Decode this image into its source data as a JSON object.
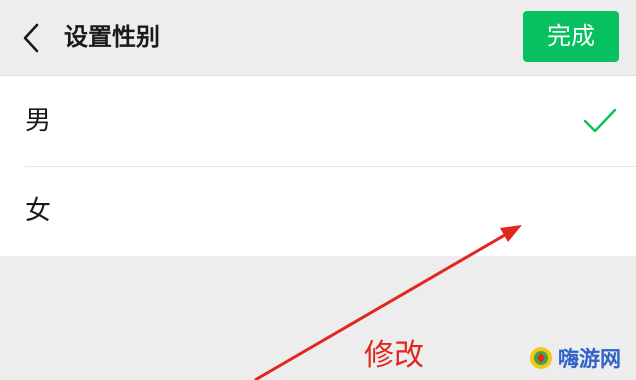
{
  "header": {
    "title": "设置性别",
    "done_label": "完成",
    "back_icon": "chevron-left-icon"
  },
  "options": [
    {
      "label": "男",
      "selected": true
    },
    {
      "label": "女",
      "selected": false
    }
  ],
  "annotation": {
    "text": "修改",
    "color": "#e0281e"
  },
  "watermark": {
    "text": "嗨游网"
  },
  "colors": {
    "accent": "#07c160",
    "background": "#ededed"
  }
}
